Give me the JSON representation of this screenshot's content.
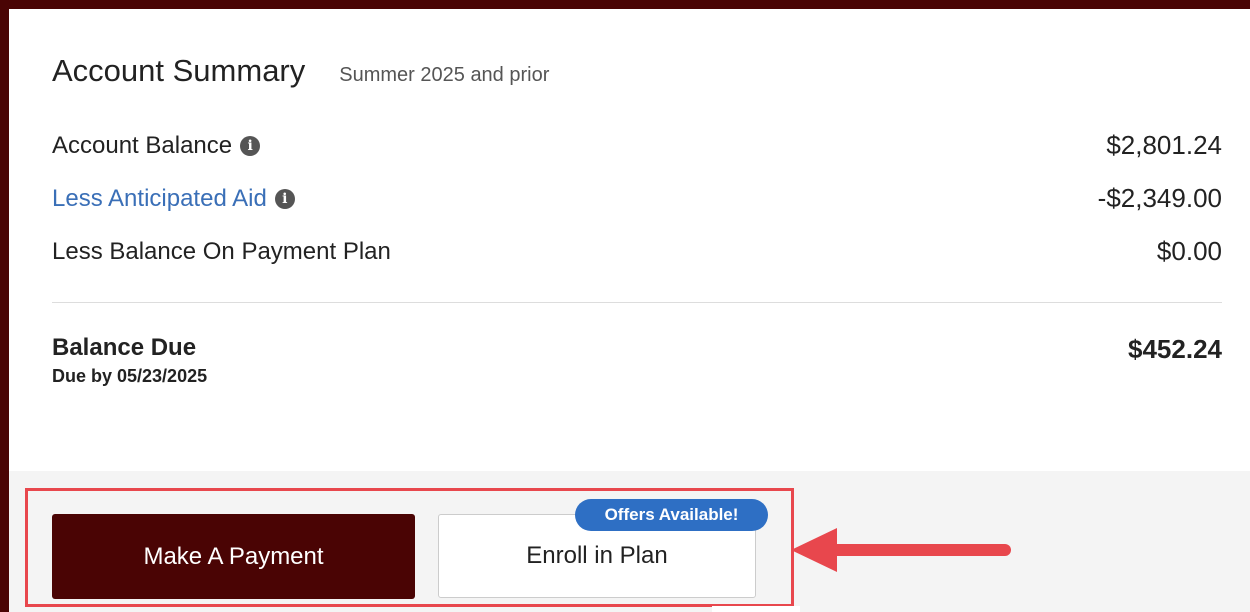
{
  "summary": {
    "title": "Account Summary",
    "subtitle": "Summer 2025 and prior"
  },
  "rows": [
    {
      "label": "Account Balance",
      "amount": "$2,801.24",
      "has_info": true
    },
    {
      "label": "Less Anticipated Aid",
      "amount": "-$2,349.00",
      "has_info": true
    },
    {
      "label": "Less Balance On Payment Plan",
      "amount": "$0.00",
      "has_info": false
    }
  ],
  "balance_due": {
    "label": "Balance Due",
    "due_date": "Due by 05/23/2025",
    "amount": "$452.24"
  },
  "actions": {
    "pay_label": "Make A Payment",
    "enroll_label": "Enroll in Plan",
    "offers_badge": "Offers Available!"
  },
  "icons": {
    "info": "info-icon",
    "annotation": "arrow-left-icon"
  },
  "colors": {
    "brand": "#4a0404",
    "link": "#3a6fb7",
    "badge": "#2e6fc4",
    "annotation": "#e8474d"
  }
}
